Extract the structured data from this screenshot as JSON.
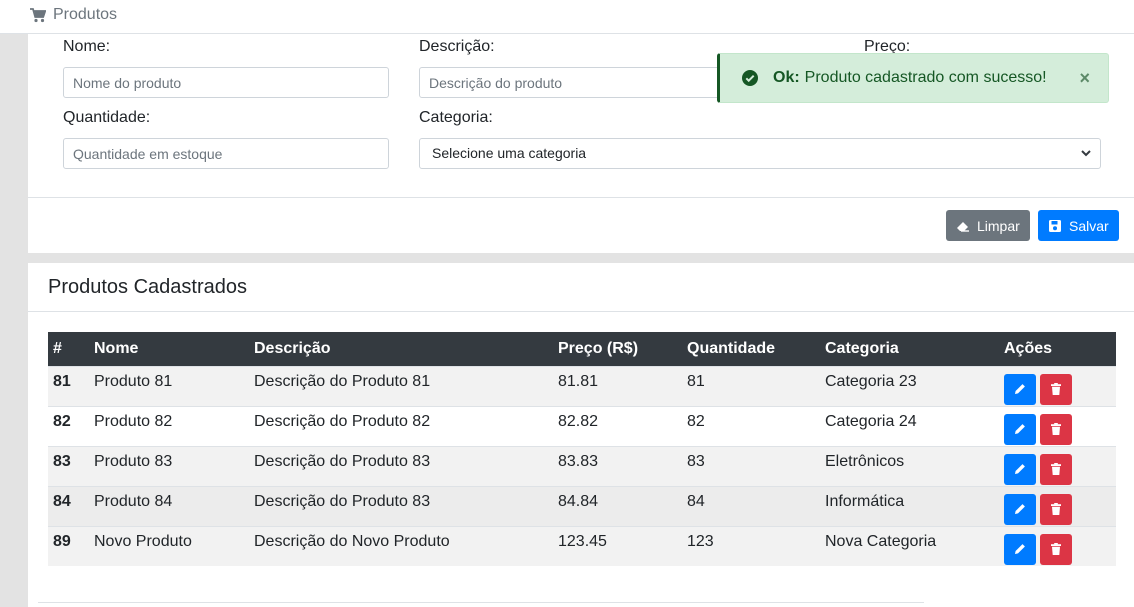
{
  "header": {
    "title": "Produtos",
    "icon": "cart-icon"
  },
  "form": {
    "nome_label": "Nome:",
    "nome_placeholder": "Nome do produto",
    "descricao_label": "Descrição:",
    "descricao_placeholder": "Descrição do produto",
    "preco_label": "Preço:",
    "quantidade_label": "Quantidade:",
    "quantidade_placeholder": "Quantidade em estoque",
    "categoria_label": "Categoria:",
    "categoria_selected": "Selecione uma categoria",
    "limpar_label": "Limpar",
    "salvar_label": "Salvar"
  },
  "alert": {
    "strong": "Ok:",
    "message": "Produto cadastrado com sucesso!",
    "close": "×"
  },
  "list": {
    "title": "Produtos Cadastrados",
    "columns": [
      "#",
      "Nome",
      "Descrição",
      "Preço (R$)",
      "Quantidade",
      "Categoria",
      "Ações"
    ],
    "rows": [
      {
        "id": "81",
        "nome": "Produto 81",
        "descricao": "Descrição do Produto 81",
        "preco": "81.81",
        "quantidade": "81",
        "categoria": "Categoria 23"
      },
      {
        "id": "82",
        "nome": "Produto 82",
        "descricao": "Descrição do Produto 82",
        "preco": "82.82",
        "quantidade": "82",
        "categoria": "Categoria 24"
      },
      {
        "id": "83",
        "nome": "Produto 83",
        "descricao": "Descrição do Produto 83",
        "preco": "83.83",
        "quantidade": "83",
        "categoria": "Eletrônicos"
      },
      {
        "id": "84",
        "nome": "Produto 84",
        "descricao": "Descrição do Produto 83",
        "preco": "84.84",
        "quantidade": "84",
        "categoria": "Informática"
      },
      {
        "id": "89",
        "nome": "Novo Produto",
        "descricao": "Descrição do Novo Produto",
        "preco": "123.45",
        "quantidade": "123",
        "categoria": "Nova Categoria"
      }
    ]
  },
  "colors": {
    "primary": "#007bff",
    "danger": "#dc3545",
    "secondary": "#6c757d",
    "success_bg": "#d4edda",
    "success_text": "#155724",
    "table_header": "#343a40"
  }
}
